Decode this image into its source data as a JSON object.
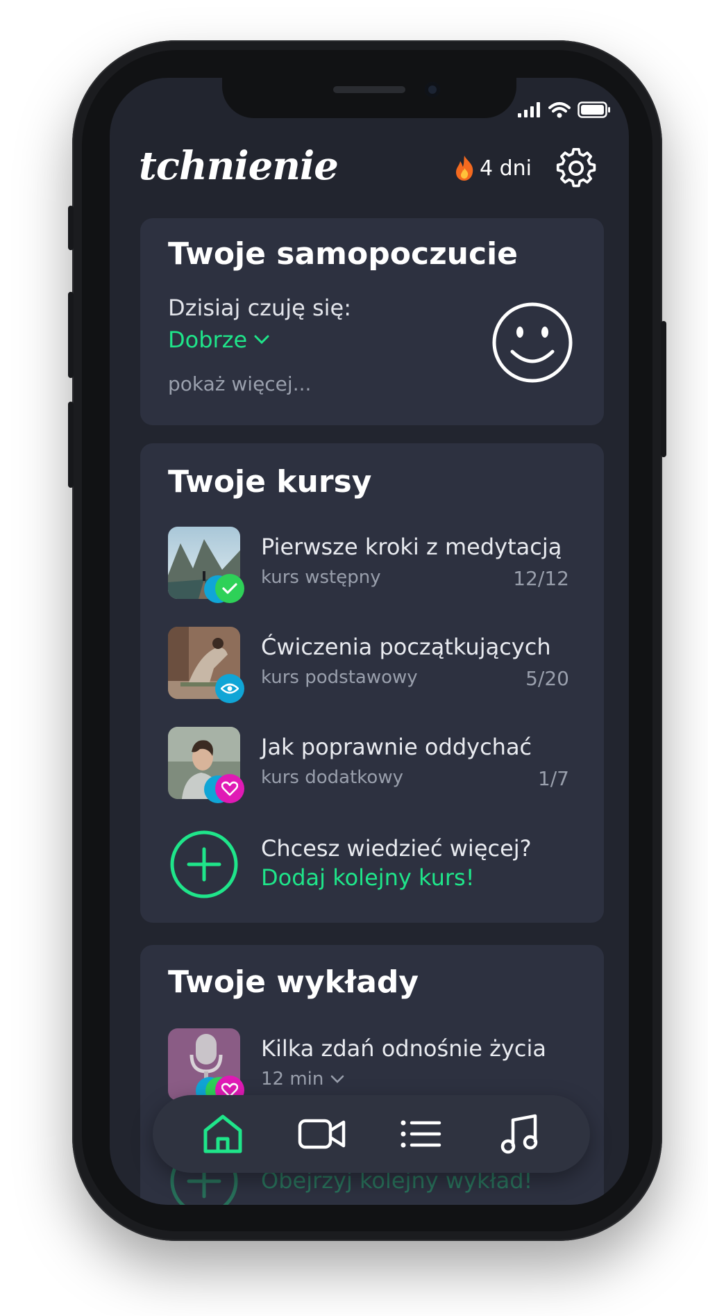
{
  "app": {
    "logo_text": "tchnienie"
  },
  "header": {
    "streak_icon": "fire-icon",
    "streak_label": "4 dni",
    "settings_icon": "gear-icon"
  },
  "wellbeing": {
    "title": "Twoje samopoczucie",
    "prompt": "Dzisiaj czuję się:",
    "selected_mood": "Dobrze",
    "show_more": "pokaż więcej...",
    "mood_icon": "smiley-icon"
  },
  "courses": {
    "title": "Twoje kursy",
    "items": [
      {
        "title": "Pierwsze kroki z medytacją",
        "subtitle": "kurs wstępny",
        "progress": "12/12",
        "status_icon": "check-icon",
        "status_color": "#2ed158",
        "thumb": "mountain-lake-photo"
      },
      {
        "title": "Ćwiczenia początkujących",
        "subtitle": "kurs podstawowy",
        "progress": "5/20",
        "status_icon": "eye-icon",
        "status_color": "#10a5d6",
        "thumb": "yoga-pose-photo"
      },
      {
        "title": "Jak poprawnie oddychać",
        "subtitle": "kurs dodatkowy",
        "progress": "1/7",
        "status_icon": "heart-icon",
        "status_color": "#e01ab5",
        "thumb": "breathing-man-photo"
      }
    ],
    "add_prompt": "Chcesz wiedzieć więcej?",
    "add_cta": "Dodaj kolejny kurs!"
  },
  "lectures": {
    "title": "Twoje wykłady",
    "items": [
      {
        "title": "Kilka zdań odnośnie życia",
        "duration": "12 min",
        "status_icon": "heart-icon",
        "thumb": "microphone-photo"
      }
    ],
    "add_cta": "Obejrzyj kolejny wykład!"
  },
  "nav": {
    "items": [
      {
        "name": "home",
        "icon": "home-icon",
        "active": true
      },
      {
        "name": "video",
        "icon": "video-camera-icon",
        "active": false
      },
      {
        "name": "list",
        "icon": "list-icon",
        "active": false
      },
      {
        "name": "music",
        "icon": "music-note-icon",
        "active": false
      }
    ]
  },
  "colors": {
    "accent": "#1fe58a",
    "background": "#22252f",
    "card": "#2d3140"
  }
}
